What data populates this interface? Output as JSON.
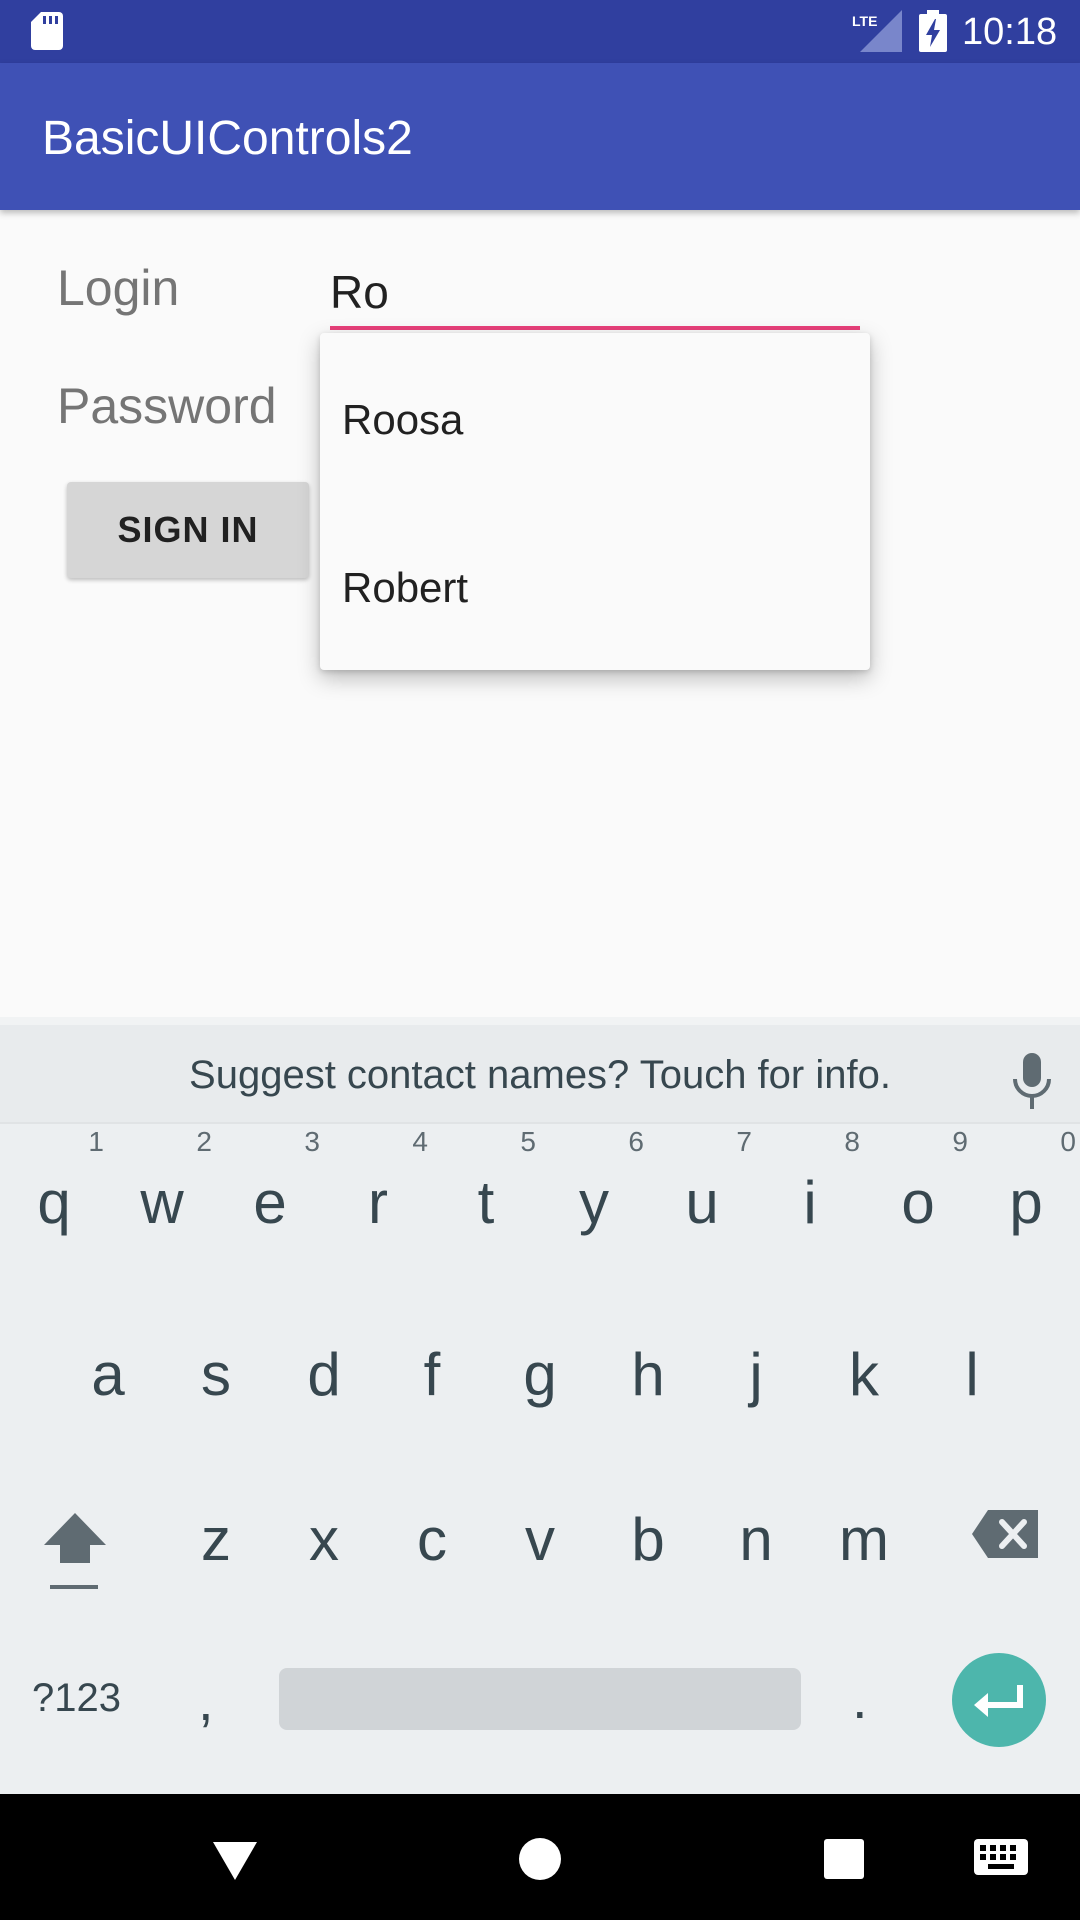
{
  "status_bar": {
    "time": "10:18",
    "network": "LTE",
    "icons": [
      "sd-card-icon",
      "signal-icon",
      "battery-charging-icon"
    ]
  },
  "app_bar": {
    "title": "BasicUIControls2"
  },
  "form": {
    "login_label": "Login",
    "login_value": "Ro",
    "password_label": "Password",
    "sign_in_label": "SIGN IN"
  },
  "autocomplete": {
    "items": [
      "Roosa",
      "Robert"
    ]
  },
  "keyboard": {
    "suggestion": "Suggest contact names? Touch for info.",
    "row1": [
      {
        "ch": "q",
        "num": "1"
      },
      {
        "ch": "w",
        "num": "2"
      },
      {
        "ch": "e",
        "num": "3"
      },
      {
        "ch": "r",
        "num": "4"
      },
      {
        "ch": "t",
        "num": "5"
      },
      {
        "ch": "y",
        "num": "6"
      },
      {
        "ch": "u",
        "num": "7"
      },
      {
        "ch": "i",
        "num": "8"
      },
      {
        "ch": "o",
        "num": "9"
      },
      {
        "ch": "p",
        "num": "0"
      }
    ],
    "row2": [
      "a",
      "s",
      "d",
      "f",
      "g",
      "h",
      "j",
      "k",
      "l"
    ],
    "row3": [
      "z",
      "x",
      "c",
      "v",
      "b",
      "n",
      "m"
    ],
    "symbols_label": "?123",
    "comma": ",",
    "period": "."
  },
  "colors": {
    "status_bar": "#303f9f",
    "app_bar": "#3f51b5",
    "accent": "#e8407a",
    "enter_key": "#4db6ac"
  }
}
